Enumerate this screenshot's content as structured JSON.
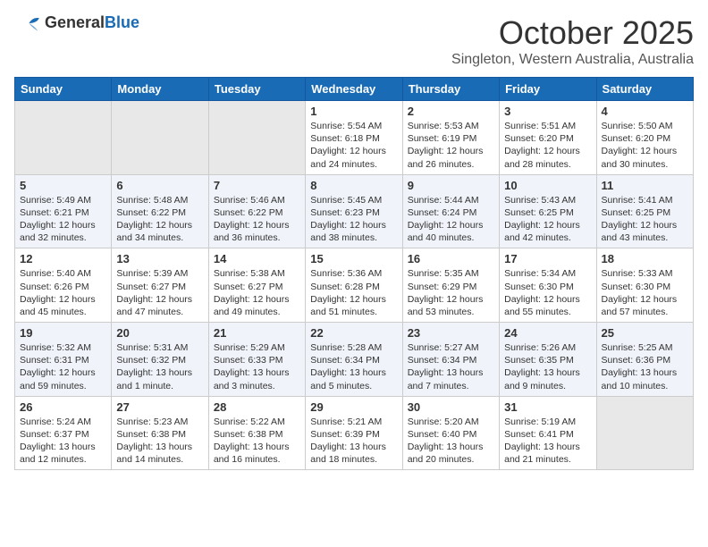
{
  "header": {
    "logo_general": "General",
    "logo_blue": "Blue",
    "month_title": "October 2025",
    "subtitle": "Singleton, Western Australia, Australia"
  },
  "weekdays": [
    "Sunday",
    "Monday",
    "Tuesday",
    "Wednesday",
    "Thursday",
    "Friday",
    "Saturday"
  ],
  "weeks": [
    [
      {
        "day": "",
        "info": ""
      },
      {
        "day": "",
        "info": ""
      },
      {
        "day": "",
        "info": ""
      },
      {
        "day": "1",
        "info": "Sunrise: 5:54 AM\nSunset: 6:18 PM\nDaylight: 12 hours\nand 24 minutes."
      },
      {
        "day": "2",
        "info": "Sunrise: 5:53 AM\nSunset: 6:19 PM\nDaylight: 12 hours\nand 26 minutes."
      },
      {
        "day": "3",
        "info": "Sunrise: 5:51 AM\nSunset: 6:20 PM\nDaylight: 12 hours\nand 28 minutes."
      },
      {
        "day": "4",
        "info": "Sunrise: 5:50 AM\nSunset: 6:20 PM\nDaylight: 12 hours\nand 30 minutes."
      }
    ],
    [
      {
        "day": "5",
        "info": "Sunrise: 5:49 AM\nSunset: 6:21 PM\nDaylight: 12 hours\nand 32 minutes."
      },
      {
        "day": "6",
        "info": "Sunrise: 5:48 AM\nSunset: 6:22 PM\nDaylight: 12 hours\nand 34 minutes."
      },
      {
        "day": "7",
        "info": "Sunrise: 5:46 AM\nSunset: 6:22 PM\nDaylight: 12 hours\nand 36 minutes."
      },
      {
        "day": "8",
        "info": "Sunrise: 5:45 AM\nSunset: 6:23 PM\nDaylight: 12 hours\nand 38 minutes."
      },
      {
        "day": "9",
        "info": "Sunrise: 5:44 AM\nSunset: 6:24 PM\nDaylight: 12 hours\nand 40 minutes."
      },
      {
        "day": "10",
        "info": "Sunrise: 5:43 AM\nSunset: 6:25 PM\nDaylight: 12 hours\nand 42 minutes."
      },
      {
        "day": "11",
        "info": "Sunrise: 5:41 AM\nSunset: 6:25 PM\nDaylight: 12 hours\nand 43 minutes."
      }
    ],
    [
      {
        "day": "12",
        "info": "Sunrise: 5:40 AM\nSunset: 6:26 PM\nDaylight: 12 hours\nand 45 minutes."
      },
      {
        "day": "13",
        "info": "Sunrise: 5:39 AM\nSunset: 6:27 PM\nDaylight: 12 hours\nand 47 minutes."
      },
      {
        "day": "14",
        "info": "Sunrise: 5:38 AM\nSunset: 6:27 PM\nDaylight: 12 hours\nand 49 minutes."
      },
      {
        "day": "15",
        "info": "Sunrise: 5:36 AM\nSunset: 6:28 PM\nDaylight: 12 hours\nand 51 minutes."
      },
      {
        "day": "16",
        "info": "Sunrise: 5:35 AM\nSunset: 6:29 PM\nDaylight: 12 hours\nand 53 minutes."
      },
      {
        "day": "17",
        "info": "Sunrise: 5:34 AM\nSunset: 6:30 PM\nDaylight: 12 hours\nand 55 minutes."
      },
      {
        "day": "18",
        "info": "Sunrise: 5:33 AM\nSunset: 6:30 PM\nDaylight: 12 hours\nand 57 minutes."
      }
    ],
    [
      {
        "day": "19",
        "info": "Sunrise: 5:32 AM\nSunset: 6:31 PM\nDaylight: 12 hours\nand 59 minutes."
      },
      {
        "day": "20",
        "info": "Sunrise: 5:31 AM\nSunset: 6:32 PM\nDaylight: 13 hours\nand 1 minute."
      },
      {
        "day": "21",
        "info": "Sunrise: 5:29 AM\nSunset: 6:33 PM\nDaylight: 13 hours\nand 3 minutes."
      },
      {
        "day": "22",
        "info": "Sunrise: 5:28 AM\nSunset: 6:34 PM\nDaylight: 13 hours\nand 5 minutes."
      },
      {
        "day": "23",
        "info": "Sunrise: 5:27 AM\nSunset: 6:34 PM\nDaylight: 13 hours\nand 7 minutes."
      },
      {
        "day": "24",
        "info": "Sunrise: 5:26 AM\nSunset: 6:35 PM\nDaylight: 13 hours\nand 9 minutes."
      },
      {
        "day": "25",
        "info": "Sunrise: 5:25 AM\nSunset: 6:36 PM\nDaylight: 13 hours\nand 10 minutes."
      }
    ],
    [
      {
        "day": "26",
        "info": "Sunrise: 5:24 AM\nSunset: 6:37 PM\nDaylight: 13 hours\nand 12 minutes."
      },
      {
        "day": "27",
        "info": "Sunrise: 5:23 AM\nSunset: 6:38 PM\nDaylight: 13 hours\nand 14 minutes."
      },
      {
        "day": "28",
        "info": "Sunrise: 5:22 AM\nSunset: 6:38 PM\nDaylight: 13 hours\nand 16 minutes."
      },
      {
        "day": "29",
        "info": "Sunrise: 5:21 AM\nSunset: 6:39 PM\nDaylight: 13 hours\nand 18 minutes."
      },
      {
        "day": "30",
        "info": "Sunrise: 5:20 AM\nSunset: 6:40 PM\nDaylight: 13 hours\nand 20 minutes."
      },
      {
        "day": "31",
        "info": "Sunrise: 5:19 AM\nSunset: 6:41 PM\nDaylight: 13 hours\nand 21 minutes."
      },
      {
        "day": "",
        "info": ""
      }
    ]
  ]
}
